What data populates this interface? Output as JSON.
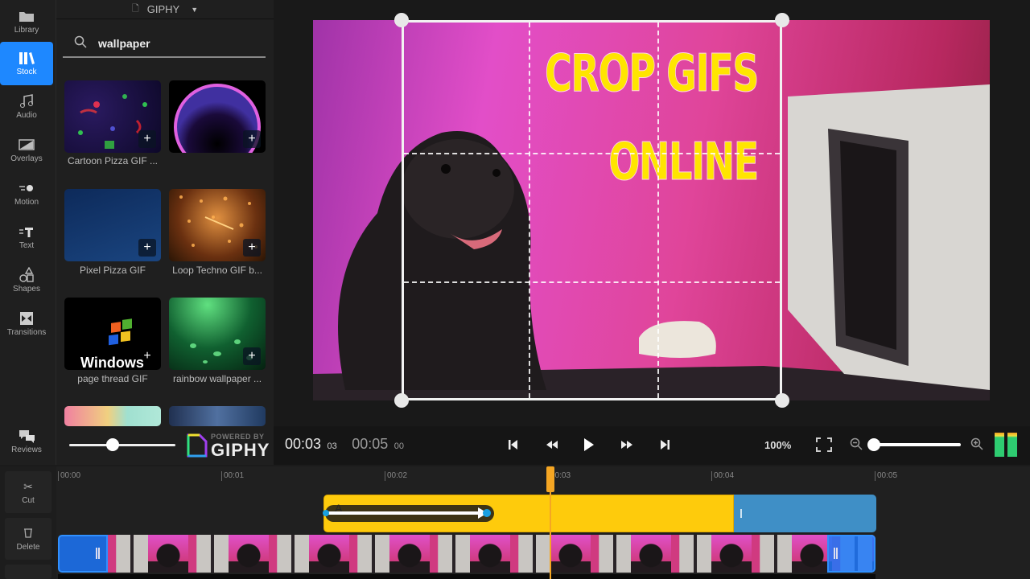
{
  "sidebar": {
    "items": [
      {
        "label": "Library",
        "icon": "folder-icon"
      },
      {
        "label": "Stock",
        "icon": "books-icon",
        "active": true
      },
      {
        "label": "Audio",
        "icon": "music-note-icon"
      },
      {
        "label": "Overlays",
        "icon": "overlay-icon"
      },
      {
        "label": "Motion",
        "icon": "motion-icon"
      },
      {
        "label": "Text",
        "icon": "text-icon"
      },
      {
        "label": "Shapes",
        "icon": "shapes-icon"
      },
      {
        "label": "Transitions",
        "icon": "transitions-icon"
      }
    ],
    "reviews_label": "Reviews"
  },
  "panel": {
    "source_label": "GIPHY",
    "search_value": "wallpaper",
    "items": [
      {
        "label": "Cartoon Pizza GIF ...",
        "colors": [
          "#120a35",
          "#2a1050"
        ]
      },
      {
        "label": "",
        "colors": [
          "#000000",
          "#1a0a30"
        ]
      },
      {
        "label": "Pixel Pizza GIF",
        "colors": [
          "#0d2a5a",
          "#1a4580"
        ]
      },
      {
        "label": "Loop Techno GIF b...",
        "colors": [
          "#6a3a10",
          "#d88a30"
        ]
      },
      {
        "label": "page thread GIF",
        "colors": [
          "#000000",
          "#050505"
        ]
      },
      {
        "label": "rainbow wallpaper ...",
        "colors": [
          "#0a3a1a",
          "#30b050"
        ]
      }
    ],
    "powered_by": "POWERED BY",
    "brand": "GIPHY",
    "thumb_size_fraction": 0.4
  },
  "preview": {
    "overlay_line1": "CROP GIFS",
    "overlay_line2": "ONLINE"
  },
  "controls": {
    "current_time": "00:03",
    "current_frame": "03",
    "total_time": "00:05",
    "total_frame": "00",
    "zoom_level": "100%",
    "zoom_fraction": 0.0
  },
  "tools": {
    "cut_label": "Cut",
    "delete_label": "Delete"
  },
  "timeline": {
    "ticks": [
      "00:00",
      "00:01",
      "00:02",
      "00:03",
      "00:04",
      "00:05"
    ],
    "playhead_seconds": 3.0,
    "overlay_clip_label": "A"
  }
}
